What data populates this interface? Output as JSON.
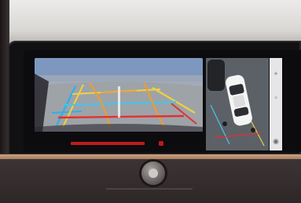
{
  "screen": {
    "rear_camera_view": {
      "guidelines": {
        "colors": {
          "near": "#e53030",
          "mid": "#f0d23c",
          "far": "#2fb0e8",
          "dynamic": "#f29b2e"
        }
      },
      "warning_bar_color": "#e02020"
    },
    "top_view": {
      "vehicle_color": "#f4f4f4"
    },
    "side_controls": {
      "icons": [
        "plus-icon",
        "camera-switch-icon",
        "settings-icon"
      ]
    }
  },
  "interior": {
    "trim_color": "#b58d6b",
    "dash_color": "#3a3232"
  }
}
